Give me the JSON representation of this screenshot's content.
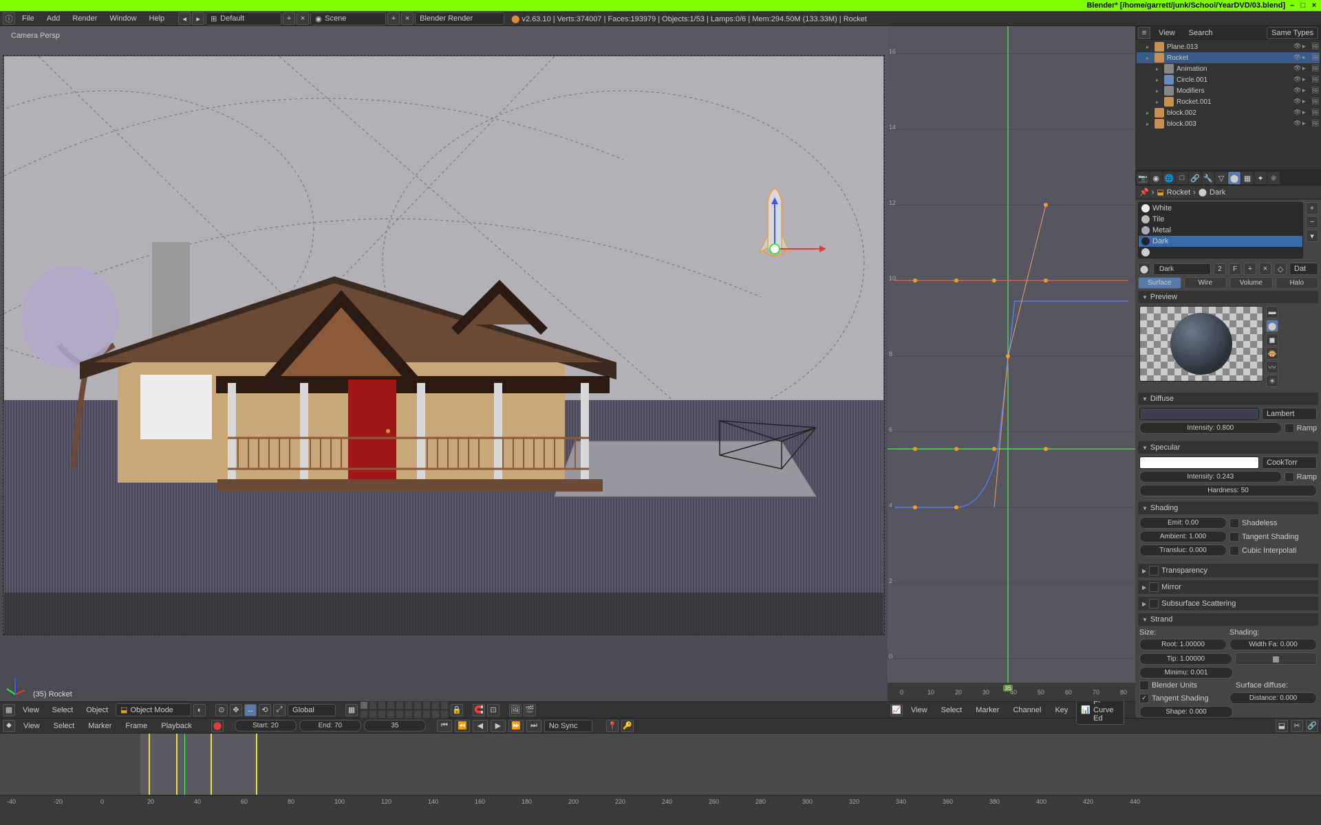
{
  "titlebar": {
    "text": "Blender* [/home/garrett/junk/School/YearDVD/03.blend]"
  },
  "topmenu": {
    "items": [
      "File",
      "Add",
      "Render",
      "Window",
      "Help"
    ],
    "layout": "Default",
    "scene": "Scene",
    "engine": "Blender Render",
    "stats": "v2.63.10 | Verts:374007 | Faces:193979 | Objects:1/53 | Lamps:0/6 | Mem:294.50M (133.33M) | Rocket"
  },
  "view3d": {
    "view_label": "Camera Persp",
    "object_label": "(35) Rocket",
    "header": {
      "menus": [
        "View",
        "Select",
        "Object"
      ],
      "mode": "Object Mode",
      "orientation": "Global"
    }
  },
  "graph": {
    "header": {
      "menus": [
        "View",
        "Select",
        "Marker",
        "Channel",
        "Key"
      ],
      "mode": "F-Curve Ed"
    },
    "frame_marker": "35",
    "x_ticks": [
      "0",
      "10",
      "20",
      "30",
      "40",
      "50",
      "60",
      "70",
      "80"
    ],
    "y_ticks": [
      "0",
      "2",
      "4",
      "6",
      "8",
      "10",
      "12",
      "14",
      "16"
    ]
  },
  "outliner": {
    "header": {
      "menus": [
        "View",
        "Search"
      ],
      "filter": "Same Types"
    },
    "items": [
      {
        "name": "Plane.013",
        "indent": 1,
        "icon": "#c78f50",
        "sel": false
      },
      {
        "name": "Rocket",
        "indent": 1,
        "icon": "#c78f50",
        "sel": true
      },
      {
        "name": "Animation",
        "indent": 2,
        "icon": "#888",
        "sel": false
      },
      {
        "name": "Circle.001",
        "indent": 2,
        "icon": "#6a8ac0",
        "sel": false
      },
      {
        "name": "Modifiers",
        "indent": 2,
        "icon": "#888",
        "sel": false
      },
      {
        "name": "Rocket.001",
        "indent": 2,
        "icon": "#c78f50",
        "sel": false
      },
      {
        "name": "block.002",
        "indent": 1,
        "icon": "#c78f50",
        "sel": false
      },
      {
        "name": "block.003",
        "indent": 1,
        "icon": "#c78f50",
        "sel": false
      }
    ]
  },
  "props": {
    "breadcrumb": {
      "obj": "Rocket",
      "mat": "Dark"
    },
    "materials": [
      {
        "name": "White",
        "color": "#eee"
      },
      {
        "name": "Tile",
        "color": "#bbb"
      },
      {
        "name": "Metal",
        "color": "#aab"
      },
      {
        "name": "Dark",
        "color": "#223",
        "sel": true
      },
      {
        "name": "",
        "color": "#ccc"
      }
    ],
    "mat_name": "Dark",
    "mat_users": "2",
    "mat_fake": "F",
    "mat_link": "Dat",
    "shading_tabs": [
      "Surface",
      "Wire",
      "Volume",
      "Halo"
    ],
    "preview_label": "Preview",
    "diffuse": {
      "label": "Diffuse",
      "shader": "Lambert",
      "intensity": "Intensity: 0.800",
      "ramp": "Ramp"
    },
    "specular": {
      "label": "Specular",
      "shader": "CookTorr",
      "intensity": "Intensity: 0.243",
      "ramp": "Ramp",
      "hardness": "Hardness: 50"
    },
    "shading": {
      "label": "Shading",
      "emit": "Emit: 0.00",
      "shadeless": "Shadeless",
      "ambient": "Ambient: 1.000",
      "tangent": "Tangent Shading",
      "transluc": "Transluc: 0.000",
      "cubic": "Cubic Interpolati"
    },
    "collapsed": [
      "Transparency",
      "Mirror",
      "Subsurface Scattering"
    ],
    "strand": {
      "label": "Strand",
      "size": "Size:",
      "shading": "Shading:",
      "root": "Root: 1.00000",
      "widthfa": "Width Fa: 0.000",
      "tip": "Tip: 1.00000",
      "min": "Minimu: 0.001",
      "blender_units": "Blender Units",
      "surface_diffuse": "Surface diffuse:",
      "tangent_shading": "Tangent Shading",
      "distance": "Distance: 0.000",
      "shape": "Shape: 0.000"
    }
  },
  "dopesheet": {
    "header": {
      "menus": [
        "View",
        "Select",
        "Marker",
        "Frame",
        "Playback"
      ]
    },
    "ruler_ticks": [
      "-40",
      "-20",
      "0",
      "20",
      "40",
      "60",
      "80",
      "100",
      "120",
      "140",
      "160",
      "180",
      "200",
      "220",
      "240",
      "260",
      "280",
      "300",
      "320",
      "340",
      "360",
      "380",
      "400",
      "420",
      "440"
    ],
    "start": "Start: 20",
    "end": "End: 70",
    "current": "35",
    "sync": "No Sync"
  }
}
